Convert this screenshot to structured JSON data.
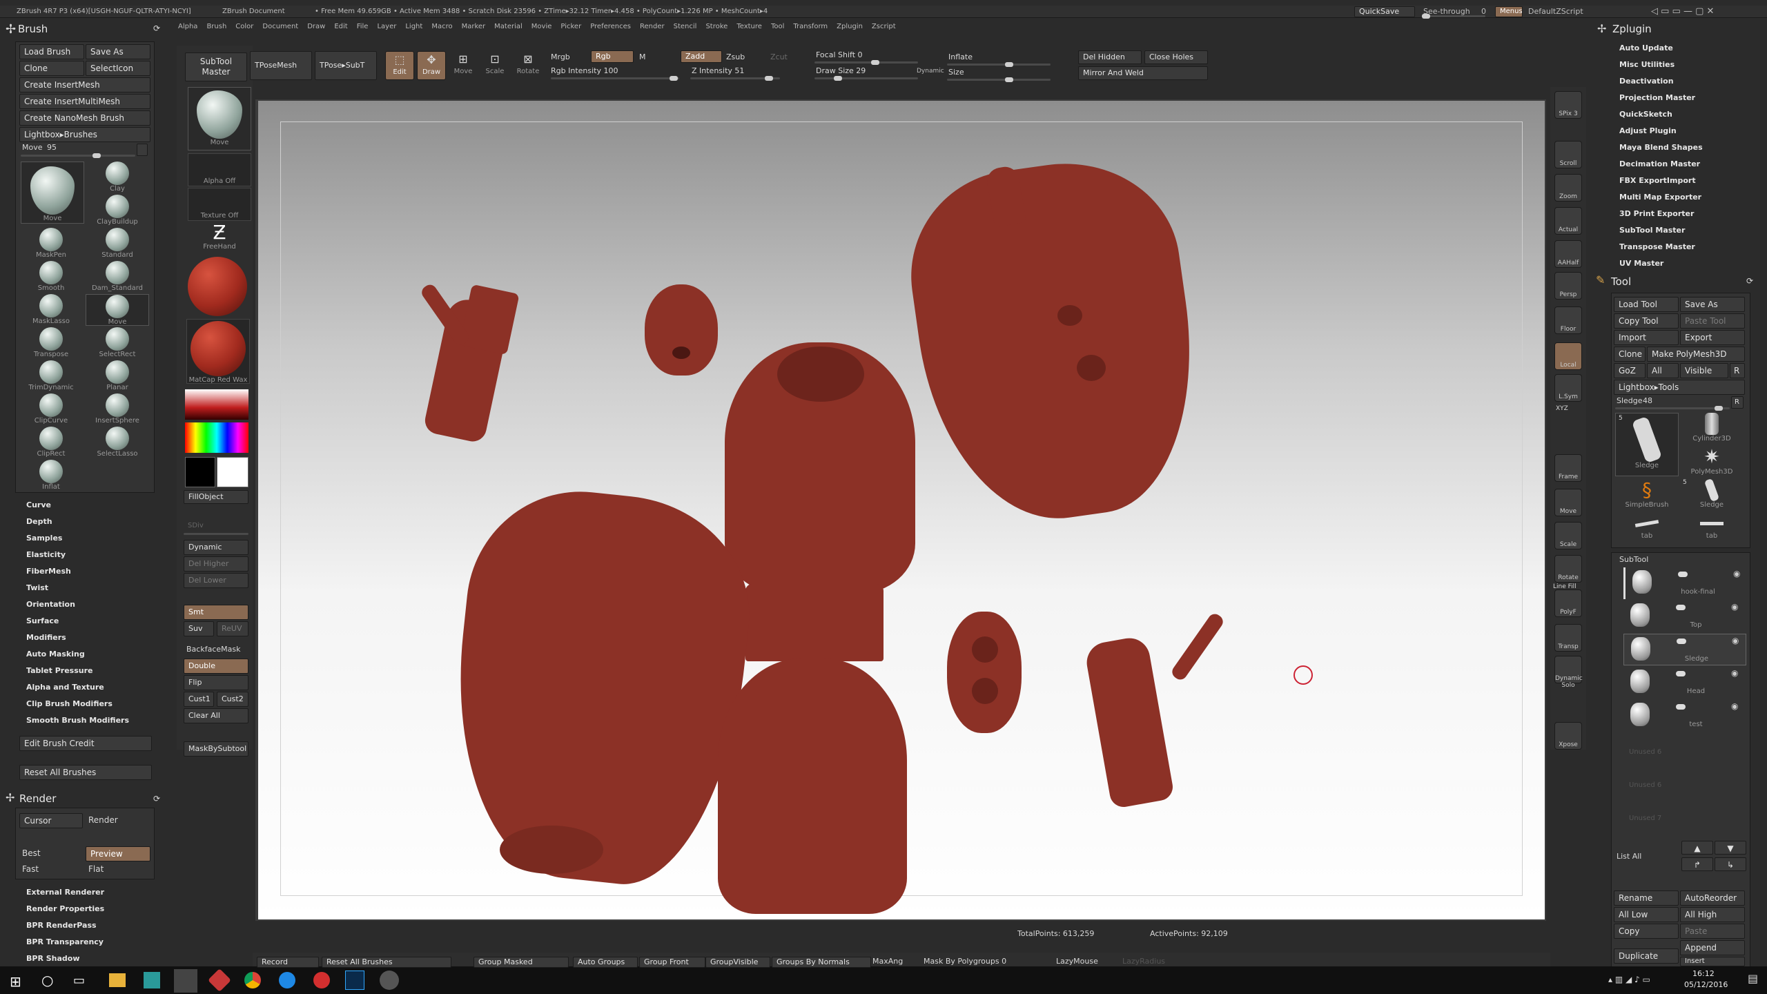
{
  "title_bar": {
    "app": "ZBrush 4R7 P3 (x64)[USGH-NGUF-QLTR-ATYI-NCYI]",
    "document": "ZBrush Document",
    "stats": "• Free Mem 49.659GB • Active Mem 3488 • Scratch Disk 23596 • ZTime▸32.12 Timer▸4.458 • PolyCount▸1.226 MP • MeshCount▸4",
    "quicksave": "QuickSave",
    "seethrough": "See-through",
    "seethrough_val": "0",
    "menus": "Menus",
    "script": "DefaultZScript"
  },
  "menu": [
    "Alpha",
    "Brush",
    "Color",
    "Document",
    "Draw",
    "Edit",
    "File",
    "Layer",
    "Light",
    "Macro",
    "Marker",
    "Material",
    "Movie",
    "Picker",
    "Preferences",
    "Render",
    "Stencil",
    "Stroke",
    "Texture",
    "Tool",
    "Transform",
    "Zplugin",
    "Zscript"
  ],
  "brush_panel": {
    "title": "Brush",
    "buttons": [
      "Load Brush",
      "Save As",
      "Clone",
      "SelectIcon",
      "Create InsertMesh",
      "Create InsertMultiMesh",
      "Create NanoMesh Brush",
      "Lightbox▸Brushes"
    ],
    "slider_label": "Move",
    "slider_value": "95",
    "r": "R",
    "big_label": "Move",
    "items": [
      "Clay",
      "ClayBuildup",
      "MaskPen",
      "Standard",
      "Smooth",
      "Dam_Standard",
      "MaskLasso",
      "Move",
      "Transpose",
      "SelectRect",
      "TrimDynamic",
      "Planar",
      "ClipCurve",
      "InsertSphere",
      "ClipRect",
      "SelectLasso",
      "Inflat"
    ],
    "sections": [
      "Curve",
      "Depth",
      "Samples",
      "Elasticity",
      "FiberMesh",
      "Twist",
      "Orientation",
      "Surface",
      "Modifiers",
      "Auto Masking",
      "Tablet Pressure",
      "Alpha and Texture",
      "Clip Brush Modifiers",
      "Smooth Brush Modifiers"
    ],
    "edit_credit": "Edit Brush Credit",
    "reset": "Reset All Brushes"
  },
  "render_panel": {
    "title": "Render",
    "cursor": "Cursor",
    "render": "Render",
    "best": "Best",
    "preview": "Preview",
    "fast": "Fast",
    "flat": "Flat",
    "sections": [
      "External Renderer",
      "Render Properties",
      "BPR RenderPass",
      "BPR Transparency",
      "BPR Shadow"
    ]
  },
  "left_shelf": {
    "subtool_master": "SubTool Master",
    "tpose": "TPoseMesh",
    "tpose_subt": "TPose▸SubT",
    "move": "Move",
    "alpha_off": "Alpha Off",
    "texture_off": "Texture Off",
    "freehand": "FreeHand",
    "matcap": "MatCap Red Wax",
    "fill": "FillObject",
    "sdiv": "SDiv",
    "dynamic": "Dynamic",
    "del_higher": "Del Higher",
    "del_lower": "Del Lower",
    "smt": "Smt",
    "suv": "Suv",
    "reuv": "ReUV",
    "backface": "BackfaceMask",
    "double": "Double",
    "flip": "Flip",
    "cust1": "Cust1",
    "cust2": "Cust2",
    "clear": "Clear All",
    "mask_by": "MaskBySubtool"
  },
  "top_toolbar": {
    "edit": "Edit",
    "draw": "Draw",
    "move": "Move",
    "scale": "Scale",
    "rotate": "Rotate",
    "mrgb": "Mrgb",
    "rgb": "Rgb",
    "m": "M",
    "zadd": "Zadd",
    "zsub": "Zsub",
    "zcut": "Zcut",
    "rgb_int": "Rgb Intensity 100",
    "z_int": "Z Intensity 51",
    "focal": "Focal Shift 0",
    "draw_size": "Draw Size 29",
    "dynamic": "Dynamic",
    "inflate": "Inflate",
    "size": "Size",
    "del_hidden": "Del Hidden",
    "close_holes": "Close Holes",
    "mirror_weld": "Mirror And Weld"
  },
  "right_shelf": [
    "SPix 3",
    "Scroll",
    "Zoom",
    "Actual",
    "AAHalf",
    "Persp",
    "Floor",
    "Local",
    "L.Sym",
    "Frame",
    "Move",
    "Scale",
    "Rotate",
    "PolyF",
    "Transp",
    "Dynamic Solo",
    "Xpose"
  ],
  "right_shelf_extra": {
    "xyz": "XYZ",
    "line_fill": "Line Fill"
  },
  "zplugin": {
    "title": "Zplugin",
    "items": [
      "Auto Update",
      "Misc Utilities",
      "Deactivation",
      "Projection Master",
      "QuickSketch",
      "Adjust Plugin",
      "Maya Blend Shapes",
      "Decimation Master",
      "FBX ExportImport",
      "Multi Map Exporter",
      "3D Print Exporter",
      "SubTool Master",
      "Transpose Master",
      "UV Master"
    ]
  },
  "tool": {
    "title": "Tool",
    "buttons": [
      "Load Tool",
      "Save As",
      "Copy Tool",
      "Paste Tool",
      "Import",
      "Export",
      "Clone",
      "Make PolyMesh3D",
      "GoZ",
      "All",
      "Visible",
      "R",
      "Lightbox▸Tools"
    ],
    "slider_label": "Sledge",
    "slider_value": "48",
    "thumbs": [
      "Sledge",
      "Cylinder3D",
      "PolyMesh3D",
      "SimpleBrush",
      "Sledge",
      "tab",
      "tab"
    ],
    "counts": [
      "5",
      "5"
    ],
    "subtool_title": "SubTool",
    "subtools": [
      "hook-final",
      "Top",
      "Sledge",
      "Head",
      "test"
    ],
    "empty": [
      "Unused 6",
      "Unused 6",
      "Unused 7"
    ],
    "list_all": "List All",
    "bottom": [
      "Rename",
      "AutoReorder",
      "All Low",
      "All High",
      "Copy",
      "Paste",
      "Append",
      "Duplicate",
      "Insert"
    ]
  },
  "canvas": {
    "total_points": "TotalPoints: 613,259",
    "active_points": "ActivePoints: 92,109"
  },
  "bottom_bar": [
    "Record",
    "Reset All Brushes",
    "Group Masked",
    "Auto Groups",
    "Group Front",
    "GroupVisible",
    "Groups By Normals",
    "MaxAng",
    "Mask By Polygroups 0",
    "LazyMouse",
    "LazyRadius"
  ],
  "taskbar": {
    "time": "16:12",
    "date": "05/12/2016"
  }
}
